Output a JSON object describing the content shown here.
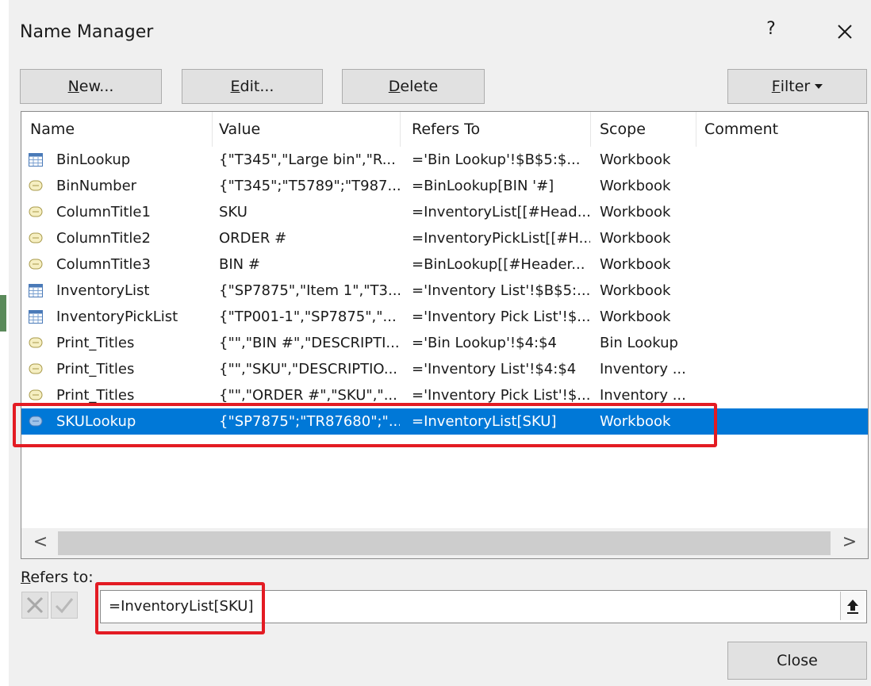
{
  "dialog": {
    "title": "Name Manager",
    "help": "?"
  },
  "toolbar": {
    "new": {
      "accel": "N",
      "rest": "ew..."
    },
    "edit": {
      "accel": "E",
      "rest": "dit..."
    },
    "delete": {
      "accel": "D",
      "rest": "elete"
    },
    "filter": {
      "accel": "F",
      "rest": "ilter"
    }
  },
  "columns": [
    "Name",
    "Value",
    "Refers To",
    "Scope",
    "Comment"
  ],
  "rows": [
    {
      "icon": "table-icon",
      "name": "BinLookup",
      "value": "{\"T345\",\"Large bin\",\"R...",
      "refers": "='Bin Lookup'!$B$5:$...",
      "scope": "Workbook",
      "comment": ""
    },
    {
      "icon": "name-icon",
      "name": "BinNumber",
      "value": "{\"T345\";\"T5789\";\"T987...",
      "refers": "=BinLookup[BIN '#]",
      "scope": "Workbook",
      "comment": ""
    },
    {
      "icon": "name-icon",
      "name": "ColumnTitle1",
      "value": "SKU",
      "refers": "=InventoryList[[#Head...",
      "scope": "Workbook",
      "comment": ""
    },
    {
      "icon": "name-icon",
      "name": "ColumnTitle2",
      "value": "ORDER #",
      "refers": "=InventoryPickList[[#H...",
      "scope": "Workbook",
      "comment": ""
    },
    {
      "icon": "name-icon",
      "name": "ColumnTitle3",
      "value": "BIN #",
      "refers": "=BinLookup[[#Header...",
      "scope": "Workbook",
      "comment": ""
    },
    {
      "icon": "table-icon",
      "name": "InventoryList",
      "value": "{\"SP7875\",\"Item 1\",\"T3...",
      "refers": "='Inventory List'!$B$5:...",
      "scope": "Workbook",
      "comment": ""
    },
    {
      "icon": "table-icon",
      "name": "InventoryPickList",
      "value": "{\"TP001-1\",\"SP7875\",\"...",
      "refers": "='Inventory Pick List'!$...",
      "scope": "Workbook",
      "comment": ""
    },
    {
      "icon": "name-icon",
      "name": "Print_Titles",
      "value": "{\"\",\"BIN #\",\"DESCRIPTI...",
      "refers": "='Bin Lookup'!$4:$4",
      "scope": "Bin Lookup",
      "comment": ""
    },
    {
      "icon": "name-icon",
      "name": "Print_Titles",
      "value": "{\"\",\"SKU\",\"DESCRIPTIO...",
      "refers": "='Inventory List'!$4:$4",
      "scope": "Inventory ...",
      "comment": ""
    },
    {
      "icon": "name-icon",
      "name": "Print_Titles",
      "value": "{\"\",\"ORDER #\",\"SKU\",\"...",
      "refers": "='Inventory Pick List'!$...",
      "scope": "Inventory ...",
      "comment": ""
    },
    {
      "icon": "name-icon",
      "name": "SKULookup",
      "value": "{\"SP7875\";\"TR87680\";\"...",
      "refers": "=InventoryList[SKU]",
      "scope": "Workbook",
      "comment": "",
      "selected": true
    }
  ],
  "scrollbar": {
    "left_arrow": "<",
    "right_arrow": ">"
  },
  "refers_to": {
    "label_accel": "R",
    "label_rest": "efers to:",
    "value": "=InventoryList[SKU]"
  },
  "close_label": "Close",
  "colors": {
    "selection": "#0078d7",
    "highlight_box": "#e31b23",
    "button_face": "#e1e1e1"
  }
}
